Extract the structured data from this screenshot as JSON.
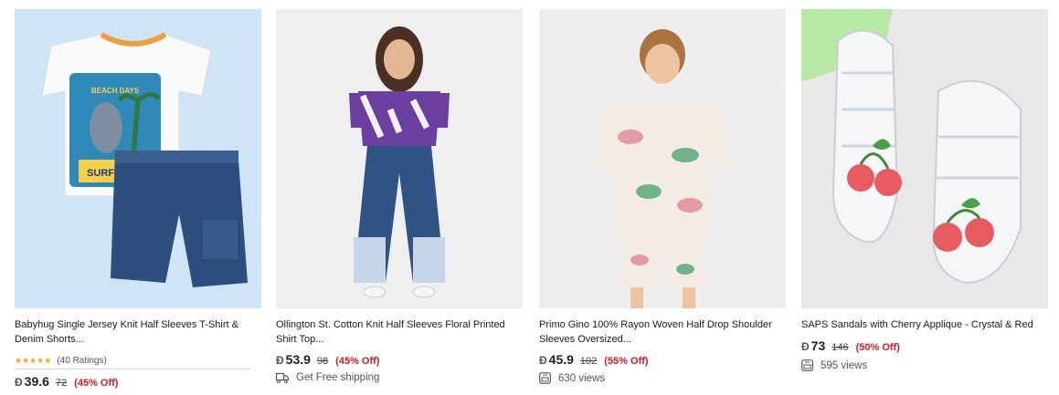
{
  "currency_symbol": "Ð",
  "products": [
    {
      "title": "Babyhug Single Jersey Knit Half Sleeves T-Shirt & Denim Shorts...",
      "stars": "★★★★★",
      "ratings": "(40 Ratings)",
      "price": "39.6",
      "old_price": "72",
      "discount": "(45% Off)",
      "image_text": [
        "BEACH DAYS",
        "SURF'S UP!"
      ]
    },
    {
      "title": "Ollington St. Cotton Knit Half Sleeves Floral Printed Shirt Top...",
      "price": "53.9",
      "old_price": "98",
      "discount": "(45% Off)",
      "meta": "Get Free shipping",
      "meta_icon": "truck-icon"
    },
    {
      "title": "Primo Gino 100% Rayon Woven Half Drop Shoulder Sleeves Oversized...",
      "price": "45.9",
      "old_price": "102",
      "discount": "(55% Off)",
      "meta": "630 views",
      "meta_icon": "views-icon"
    },
    {
      "title": "SAPS Sandals with Cherry Applique - Crystal & Red",
      "price": "73",
      "old_price": "146",
      "discount": "(50% Off)",
      "meta": "595 views",
      "meta_icon": "views-icon"
    }
  ],
  "colors": {
    "discount": "#e0161e",
    "star": "#f5a623"
  }
}
